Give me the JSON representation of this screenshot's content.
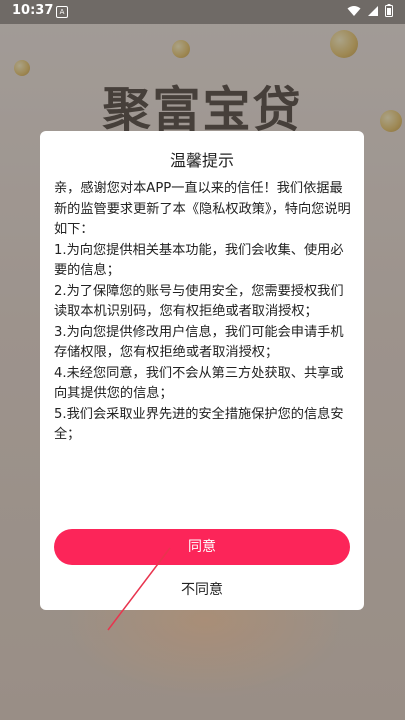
{
  "status_bar": {
    "time": "10:37",
    "notification_glyph": "A"
  },
  "background": {
    "app_title": "聚富宝贷"
  },
  "dialog": {
    "title": "温馨提示",
    "paragraphs": [
      "亲，感谢您对本APP一直以来的信任！我们依据最新的监管要求更新了本《隐私权政策》，特向您说明如下：",
      " 1.为向您提供相关基本功能，我们会收集、使用必要的信息；",
      " 2.为了保障您的账号与使用安全，您需要授权我们读取本机识别码，您有权拒绝或者取消授权；",
      " 3.为向您提供修改用户信息，我们可能会申请手机存储权限，您有权拒绝或者取消授权；",
      " 4.未经您同意，我们不会从第三方处获取、共享或向其提供您的信息；",
      " 5.我们会采取业界先进的安全措施保护您的信息安全；"
    ],
    "agree_label": "同意",
    "disagree_label": "不同意"
  },
  "colors": {
    "accent": "#fc2559",
    "pointer": "#e8344e"
  },
  "icons": {
    "wifi": "wifi-icon",
    "signal": "signal-icon",
    "battery": "battery-icon"
  }
}
